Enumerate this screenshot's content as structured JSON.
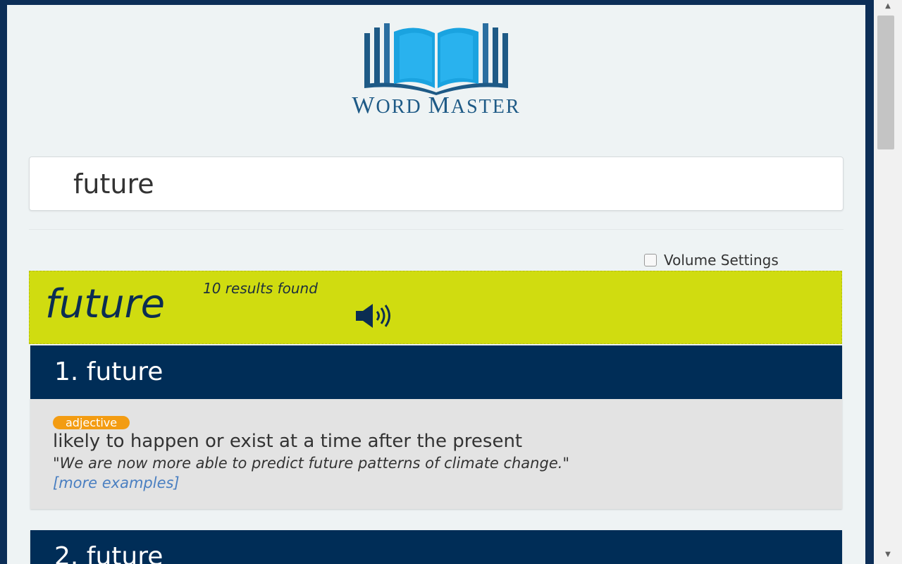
{
  "app": {
    "logo_word1_initial": "W",
    "logo_word1_rest": "ORD",
    "logo_word2_initial": "M",
    "logo_word2_rest": "ASTER"
  },
  "search": {
    "value": "future",
    "placeholder": ""
  },
  "settings": {
    "volume_label": "Volume Settings",
    "volume_checked": false
  },
  "banner": {
    "word": "future",
    "results_text": "10 results found",
    "speaker_icon": "speaker-icon"
  },
  "results": [
    {
      "heading": "1. future",
      "part_of_speech": "adjective",
      "definition": "likely to happen or exist at a time after the present",
      "example": "\"We are now more able to predict future patterns of climate change.\"",
      "more_link": "[more examples]"
    },
    {
      "heading": "2. future"
    }
  ],
  "colors": {
    "frame": "#0c2e57",
    "panel_bg": "#eef3f4",
    "banner_bg": "#d0dc10",
    "result_header": "#002d57",
    "badge": "#f39c12",
    "link": "#4a7fc1"
  }
}
